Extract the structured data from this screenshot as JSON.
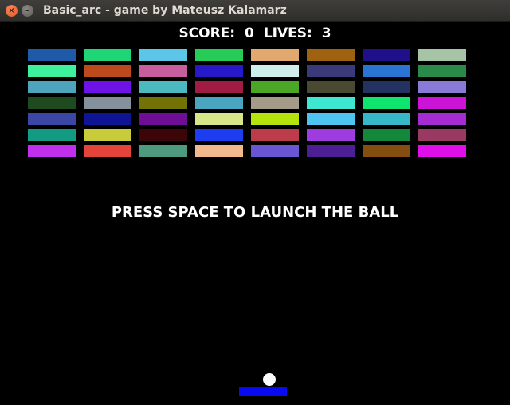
{
  "window": {
    "title": "Basic_arc - game by Mateusz Kalamarz",
    "close_glyph": "×",
    "minimize_glyph": "–"
  },
  "hud": {
    "score_label": "SCORE:",
    "score": "0",
    "lives_label": "LIVES:",
    "lives": "3"
  },
  "message": "PRESS SPACE TO LAUNCH THE BALL",
  "colors": {
    "background": "#000000",
    "paddle": "#0a0af2",
    "ball": "#ffffff"
  },
  "bricks": [
    [
      "#1f5aa8",
      "#1fd676",
      "#5bc6e8",
      "#27cc58",
      "#e2a96f",
      "#9e6210",
      "#1f0f8a",
      "#a8c4a6"
    ],
    [
      "#3ef09c",
      "#bc4a1d",
      "#c85e9e",
      "#2718c8",
      "#cdeeea",
      "#3a3a7a",
      "#2a74d4",
      "#2a8a4a"
    ],
    [
      "#4ea4bc",
      "#6e12e6",
      "#4cb8c0",
      "#a01c44",
      "#4aa826",
      "#4a4a32",
      "#243262",
      "#8a7ad8"
    ],
    [
      "#1e4a1e",
      "#84909c",
      "#727206",
      "#4aa6c0",
      "#a49c88",
      "#3ee8d0",
      "#0ee46e",
      "#cc14d8"
    ],
    [
      "#3c46a4",
      "#0e1494",
      "#6e0e96",
      "#d8e68a",
      "#b4e40c",
      "#4ec4f0",
      "#36b8c8",
      "#a42cd2"
    ],
    [
      "#129a82",
      "#c8cc3a",
      "#3c0608",
      "#1e3cf0",
      "#bc3c4a",
      "#9e3ce0",
      "#14883a",
      "#983a62"
    ],
    [
      "#c030ec",
      "#e4443a",
      "#4e9a7e",
      "#f2b88e",
      "#6a56d4",
      "#4c2094",
      "#844e10",
      "#e00ee8"
    ]
  ]
}
